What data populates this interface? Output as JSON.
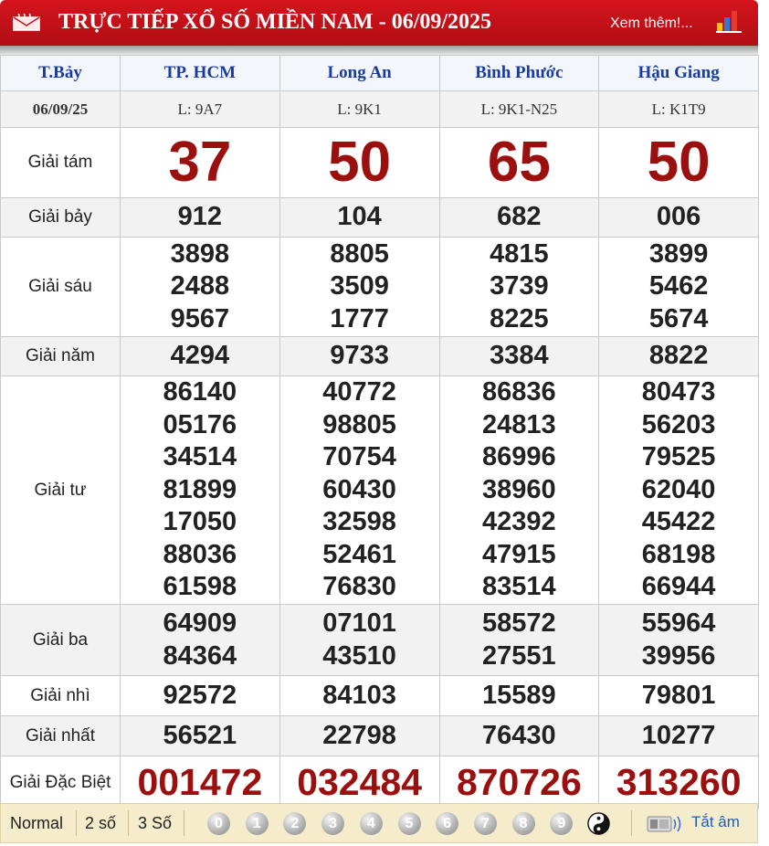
{
  "header": {
    "title": "TRỰC TIẾP XỔ SỐ MIỀN NAM - 06/09/2025",
    "more_link": "Xem thêm!..."
  },
  "table": {
    "day": "T.Bảy",
    "date": "06/09/25",
    "provinces": [
      {
        "name": "TP. HCM",
        "code": "L: 9A7"
      },
      {
        "name": "Long An",
        "code": "L: 9K1"
      },
      {
        "name": "Bình Phước",
        "code": "L: 9K1-N25"
      },
      {
        "name": "Hậu Giang",
        "code": "L: K1T9"
      }
    ],
    "prizes": [
      {
        "label": "Giải tám",
        "values": [
          [
            "37"
          ],
          [
            "50"
          ],
          [
            "65"
          ],
          [
            "50"
          ]
        ]
      },
      {
        "label": "Giải bảy",
        "values": [
          [
            "912"
          ],
          [
            "104"
          ],
          [
            "682"
          ],
          [
            "006"
          ]
        ]
      },
      {
        "label": "Giải sáu",
        "values": [
          [
            "3898",
            "2488",
            "9567"
          ],
          [
            "8805",
            "3509",
            "1777"
          ],
          [
            "4815",
            "3739",
            "8225"
          ],
          [
            "3899",
            "5462",
            "5674"
          ]
        ]
      },
      {
        "label": "Giải năm",
        "values": [
          [
            "4294"
          ],
          [
            "9733"
          ],
          [
            "3384"
          ],
          [
            "8822"
          ]
        ]
      },
      {
        "label": "Giải tư",
        "values": [
          [
            "86140",
            "05176",
            "34514",
            "81899",
            "17050",
            "88036",
            "61598"
          ],
          [
            "40772",
            "98805",
            "70754",
            "60430",
            "32598",
            "52461",
            "76830"
          ],
          [
            "86836",
            "24813",
            "86996",
            "38960",
            "42392",
            "47915",
            "83514"
          ],
          [
            "80473",
            "56203",
            "79525",
            "62040",
            "45422",
            "68198",
            "66944"
          ]
        ]
      },
      {
        "label": "Giải ba",
        "values": [
          [
            "64909",
            "84364"
          ],
          [
            "07101",
            "43510"
          ],
          [
            "58572",
            "27551"
          ],
          [
            "55964",
            "39956"
          ]
        ]
      },
      {
        "label": "Giải nhì",
        "values": [
          [
            "92572"
          ],
          [
            "84103"
          ],
          [
            "15589"
          ],
          [
            "79801"
          ]
        ]
      },
      {
        "label": "Giải nhất",
        "values": [
          [
            "56521"
          ],
          [
            "22798"
          ],
          [
            "76430"
          ],
          [
            "10277"
          ]
        ]
      },
      {
        "label": "Giải Đặc Biệt",
        "values": [
          [
            "001472"
          ],
          [
            "032484"
          ],
          [
            "870726"
          ],
          [
            "313260"
          ]
        ]
      }
    ]
  },
  "footer": {
    "modes": [
      "Normal",
      "2 số",
      "3 Số"
    ],
    "digits": [
      "0",
      "1",
      "2",
      "3",
      "4",
      "5",
      "6",
      "7",
      "8",
      "9"
    ],
    "mute_label": "Tắt âm"
  },
  "colors": {
    "header_red": "#c8101a",
    "prize_red": "#9c0f0f",
    "province_blue": "#1a3c9e",
    "footer_bg": "#f5eccc"
  },
  "icons": {
    "header_left": "mail-icon",
    "header_right": "bar-chart-icon",
    "footer_toggle": "yin-yang-icon",
    "footer_sound": "speaker-icon"
  }
}
